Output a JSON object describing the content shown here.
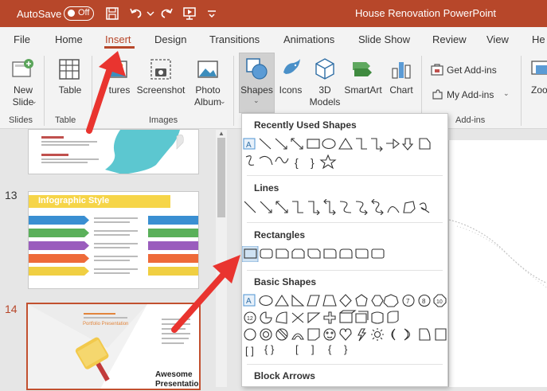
{
  "titlebar": {
    "autosave_label": "AutoSave",
    "toggle_state": "Off",
    "document_title": "House Renovation PowerPoint",
    "bar_color": "#b7472a"
  },
  "tabs": [
    {
      "label": "File"
    },
    {
      "label": "Home"
    },
    {
      "label": "Insert",
      "active": true
    },
    {
      "label": "Design"
    },
    {
      "label": "Transitions"
    },
    {
      "label": "Animations"
    },
    {
      "label": "Slide Show"
    },
    {
      "label": "Review"
    },
    {
      "label": "View"
    },
    {
      "label": "He"
    }
  ],
  "ribbon": {
    "new_slide": "New\nSlide",
    "table": "Table",
    "pictures": "tures",
    "screenshot": "Screenshot",
    "photo_album": "Photo\nAlbum",
    "shapes": "Shapes",
    "icons": "Icons",
    "models_3d": "3D\nModels",
    "smartart": "SmartArt",
    "chart": "Chart",
    "get_addins": "Get Add-ins",
    "my_addins": "My Add-ins",
    "zoom": "Zoo",
    "groups": {
      "slides": "Slides",
      "tables": "Table",
      "images": "Images",
      "addins": "Add-ins"
    }
  },
  "slides": [
    {
      "number": "13",
      "title": "Infographic Style"
    },
    {
      "number": "14",
      "title": "Portfolio Presentation",
      "caption_1": "Awesome",
      "caption_2": "Presentation",
      "selected": true
    }
  ],
  "shapes_menu": {
    "sections": [
      {
        "label": "Recently Used Shapes"
      },
      {
        "label": "Lines"
      },
      {
        "label": "Rectangles"
      },
      {
        "label": "Basic Shapes"
      },
      {
        "label": "Block Arrows"
      }
    ],
    "basic_symbols": [
      "{ }",
      "{",
      "}",
      "[",
      "]"
    ]
  },
  "colors": {
    "accent": "#b7472a",
    "arrow": "#e9342f"
  }
}
